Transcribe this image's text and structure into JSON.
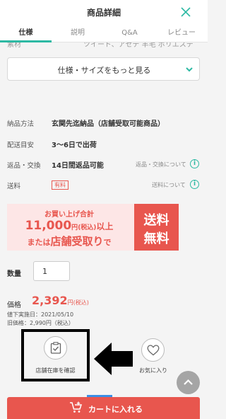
{
  "header": {
    "title": "商品詳細"
  },
  "tabs": [
    "仕様",
    "説明",
    "Q&A",
    "レビュー"
  ],
  "cut_row": {
    "left": "素材",
    "right": "ツイード、アセテ 羊毛 ポリエステ"
  },
  "spec_button": {
    "label": "仕様・サイズをもっと見る"
  },
  "info": {
    "delivery_method": {
      "label": "納品方法",
      "value": "玄関先迄納品（店舗受取可能商品）"
    },
    "delivery_estimate": {
      "label": "配送目安",
      "value": "3〜6日で出荷"
    },
    "returns": {
      "label": "返品・交換",
      "value": "14日間返品可能",
      "note": "返品・交換について"
    },
    "shipping": {
      "label": "送料",
      "badge": "有料",
      "note": "送料について"
    }
  },
  "banner": {
    "line1": "お買い上げ合計",
    "amount": "11,000",
    "unit": "円",
    "tax": "(税込)",
    "suffix": "以上",
    "line3_pre": "または",
    "line3_bold": "店舗受取り",
    "line3_post": "で",
    "free_line1": "送料",
    "free_line2": "無料"
  },
  "quantity": {
    "label": "数量",
    "value": "1"
  },
  "price": {
    "label": "価格",
    "value": "2,392",
    "unit": "円(税込)",
    "reduced_date": "値下実施日：2021/05/10",
    "old_price": "旧価格：2,990円（税込）"
  },
  "actions": {
    "store_stock": "店舗在庫を確認",
    "favorite": "お気に入り"
  },
  "cart": {
    "label": "カートに入れる"
  },
  "colors": {
    "accent": "#2db9a3",
    "sale": "#e8564e"
  }
}
